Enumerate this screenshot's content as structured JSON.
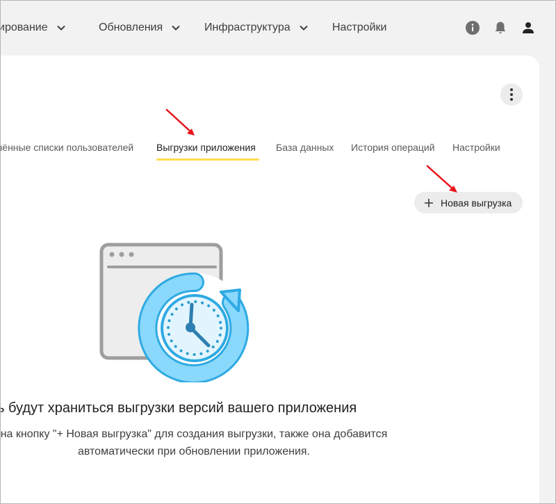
{
  "nav": {
    "items": [
      {
        "label": "ирование",
        "has_dropdown": true
      },
      {
        "label": "Обновления",
        "has_dropdown": true
      },
      {
        "label": "Инфраструктура",
        "has_dropdown": true
      },
      {
        "label": "Настройки",
        "has_dropdown": false
      }
    ],
    "icons": [
      "info-icon",
      "bell-icon",
      "user-icon"
    ]
  },
  "tabs": [
    {
      "label": "чённые списки пользователей",
      "active": false
    },
    {
      "label": "Выгрузки приложения",
      "active": true
    },
    {
      "label": "База данных",
      "active": false
    },
    {
      "label": "История операций",
      "active": false
    },
    {
      "label": "Настройки",
      "active": false
    }
  ],
  "toolbar": {
    "new_export_label": "Новая выгрузка"
  },
  "empty_state": {
    "title": "сь будут храниться выгрузки версий вашего приложения",
    "description_line1": "на кнопку \"+ Новая выгрузка\" для создания выгрузки, также она добавится",
    "description_line2": "автоматически при обновлении приложения."
  },
  "colors": {
    "accent_underline": "#ffdb4d",
    "annotation_arrow": "#e8141b",
    "illustration_blue": "#4fc3f7"
  }
}
